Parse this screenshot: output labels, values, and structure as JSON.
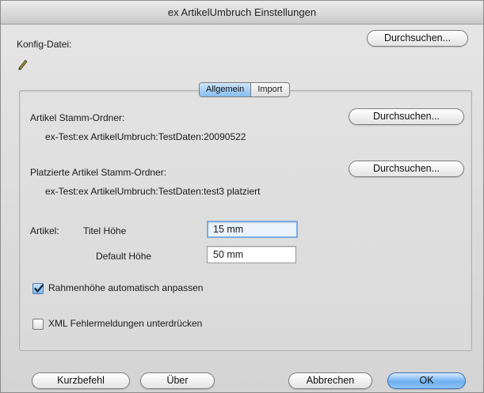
{
  "window": {
    "title": "ex ArtikelUmbruch Einstellungen"
  },
  "config": {
    "label": "Konfig-Datei:",
    "browse_label": "Durchsuchen..."
  },
  "tabs": [
    {
      "label": "Allgemein",
      "active": true
    },
    {
      "label": "Import",
      "active": false
    }
  ],
  "artikel_stamm": {
    "label": "Artikel Stamm-Ordner:",
    "path": "ex-Test:ex ArtikelUmbruch:TestDaten:20090522",
    "browse_label": "Durchsuchen..."
  },
  "platzierte_stamm": {
    "label": "Platzierte Artikel Stamm-Ordner:",
    "path": "ex-Test:ex ArtikelUmbruch:TestDaten:test3 platziert",
    "browse_label": "Durchsuchen..."
  },
  "artikel": {
    "label": "Artikel:",
    "titel_label": "Titel Höhe",
    "titel_value": "15 mm",
    "default_label": "Default Höhe",
    "default_value": "50 mm"
  },
  "checkboxes": {
    "rahmen": {
      "label": "Rahmenhöhe automatisch anpassen",
      "checked": true
    },
    "xml": {
      "label": "XML Fehlermeldungen unterdrücken",
      "checked": false
    }
  },
  "footer": {
    "shortcut_label": "Kurzbefehl",
    "about_label": "Über",
    "cancel_label": "Abbrechen",
    "ok_label": "OK"
  },
  "colors": {
    "accent": "#6fb0f0",
    "focus_border": "#7cadde"
  },
  "icons": {
    "config_file": "pencil-icon",
    "check": "checkmark-icon"
  }
}
